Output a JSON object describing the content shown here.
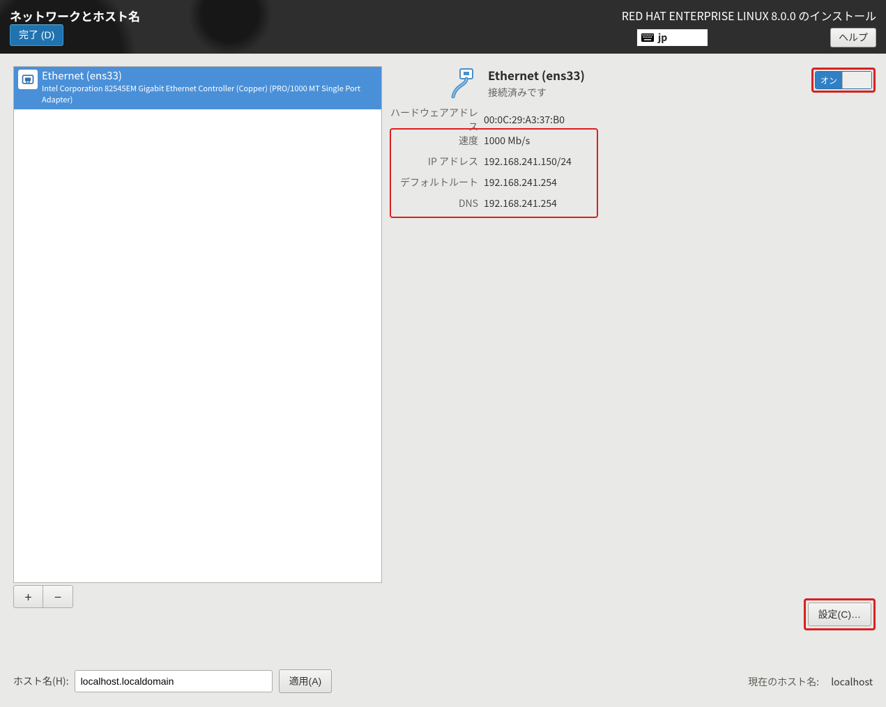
{
  "header": {
    "title": "ネットワークとホスト名",
    "done_label": "完了 (D)",
    "product": "RED HAT ENTERPRISE LINUX 8.0.0 のインストール",
    "keyboard": "jp",
    "help_label": "ヘルプ"
  },
  "device_list": {
    "items": [
      {
        "name": "Ethernet (ens33)",
        "sub": "Intel Corporation 82545EM Gigabit Ethernet Controller (Copper) (PRO/1000 MT Single Port Adapter)"
      }
    ],
    "add_label": "+",
    "remove_label": "−"
  },
  "detail": {
    "name": "Ethernet (ens33)",
    "status": "接続済みです",
    "toggle_on_label": "オン",
    "rows": {
      "hwaddr_label": "ハードウェアアドレス",
      "hwaddr": "00:0C:29:A3:37:B0",
      "speed_label": "速度",
      "speed": "1000 Mb/s",
      "ip_label": "IP アドレス",
      "ip": "192.168.241.150/24",
      "route_label": "デフォルトルート",
      "route": "192.168.241.254",
      "dns_label": "DNS",
      "dns": "192.168.241.254"
    },
    "config_label": "設定(C)…"
  },
  "hostname": {
    "label": "ホスト名(H):",
    "value": "localhost.localdomain",
    "apply_label": "適用(A)",
    "current_label": "現在のホスト名:",
    "current_value": "localhost"
  }
}
